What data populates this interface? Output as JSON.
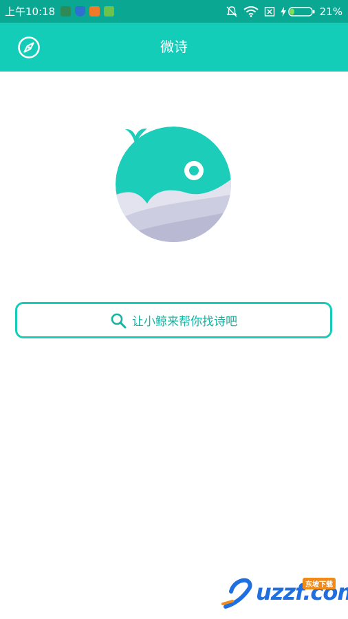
{
  "status_bar": {
    "time": "上午10:18",
    "battery_percent": "21%",
    "battery_level": 0.21,
    "left_icons": [
      "download-app-icon",
      "shield-icon",
      "game-app-icon",
      "battery-app-icon"
    ],
    "right_icons": [
      "mute-icon",
      "wifi-icon",
      "no-sim-icon",
      "charging-icon",
      "battery-icon"
    ]
  },
  "app_bar": {
    "title": "微诗",
    "left_icon": "compass-icon"
  },
  "logo": {
    "icon": "whale-logo"
  },
  "search": {
    "placeholder": "让小鲸来帮你找诗吧",
    "icon": "search-icon"
  },
  "watermark": {
    "text": "uzzf.com",
    "tag": "东坡下载"
  },
  "colors": {
    "status_bar": "#0aa793",
    "accent": "#14cdb8",
    "search_text": "#14b4a3",
    "background": "#ffffff"
  }
}
